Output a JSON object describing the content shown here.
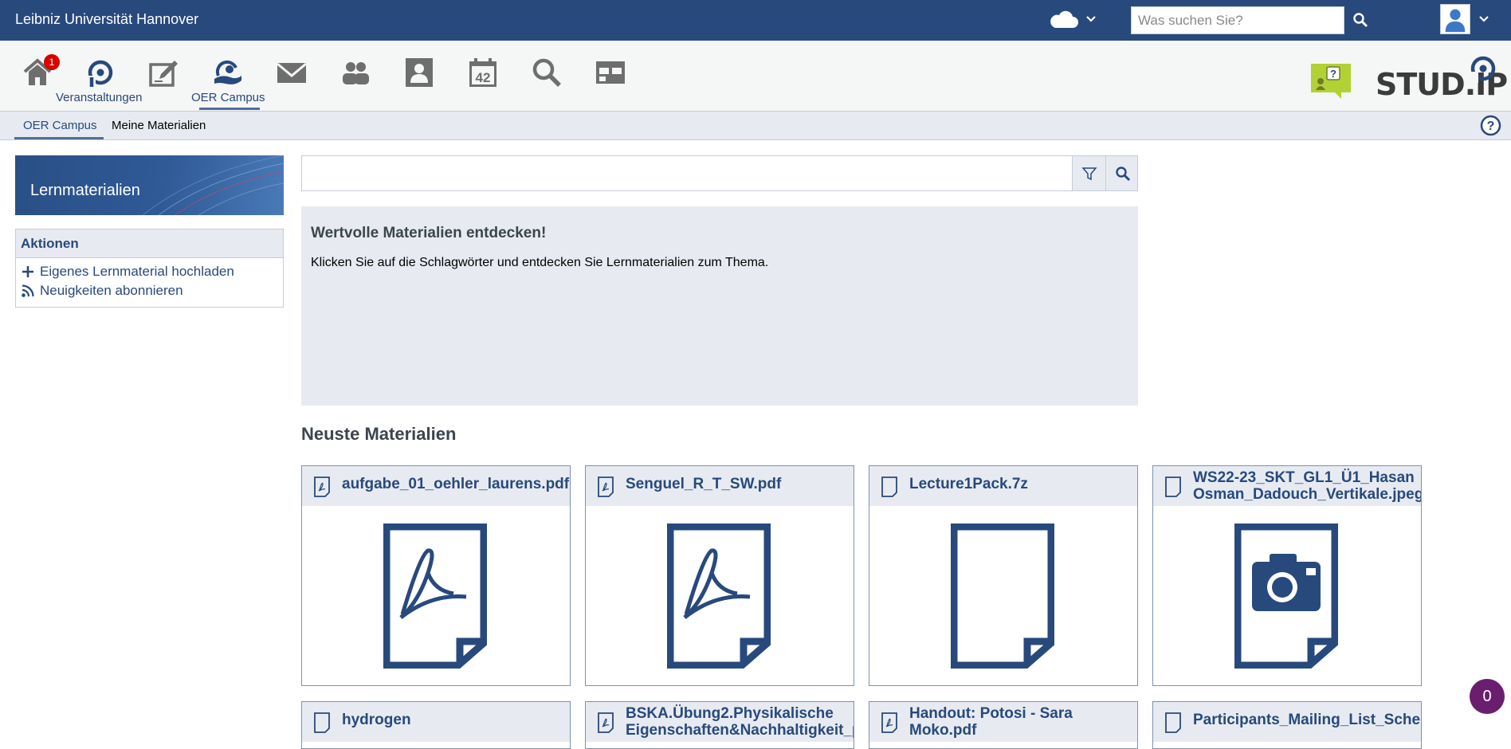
{
  "header": {
    "university": "Leibniz Universität Hannover",
    "search_placeholder": "Was suchen Sie?",
    "icons": [
      "cloud-icon",
      "chevron-down-icon",
      "search-icon",
      "avatar-icon"
    ]
  },
  "nav": {
    "home_badge": "1",
    "items": [
      {
        "icon": "home-icon",
        "label": ""
      },
      {
        "icon": "courses-icon",
        "label": "Veranstaltungen"
      },
      {
        "icon": "edit-icon",
        "label": ""
      },
      {
        "icon": "oer-campus-icon",
        "label": "OER Campus"
      },
      {
        "icon": "mail-icon",
        "label": ""
      },
      {
        "icon": "community-icon",
        "label": ""
      },
      {
        "icon": "profile-icon",
        "label": ""
      },
      {
        "icon": "calendar-icon",
        "label": ""
      },
      {
        "icon": "search-icon",
        "label": ""
      },
      {
        "icon": "tools-icon",
        "label": ""
      }
    ],
    "calendar_day": "42",
    "logo_text": "STUD.IP"
  },
  "tabs": {
    "items": [
      "OER Campus",
      "Meine Materialien"
    ],
    "active": "OER Campus"
  },
  "sidebar": {
    "banner_title": "Lernmaterialien",
    "actions_title": "Aktionen",
    "actions": [
      {
        "icon": "plus-icon",
        "label": "Eigenes Lernmaterial hochladen"
      },
      {
        "icon": "rss-icon",
        "label": "Neuigkeiten abonnieren"
      }
    ]
  },
  "main": {
    "search_value": "",
    "discover_title": "Wertvolle Materialien entdecken!",
    "discover_text": "Klicken Sie auf die Schlagwörter und entdecken Sie Lernmaterialien zum Thema.",
    "section_title": "Neuste Materialien",
    "cards": [
      {
        "title": "aufgabe_01_oehler_laurens.pdf",
        "type": "pdf"
      },
      {
        "title": "Senguel_R_T_SW.pdf",
        "type": "pdf"
      },
      {
        "title": "Lecture1Pack.7z",
        "type": "file"
      },
      {
        "title_line1": "WS22-23_SKT_GL1_Ü1_Hasan",
        "title_line2": "Osman_Dadouch_Vertikale.jpeg",
        "type": "image"
      },
      {
        "title": "hydrogen",
        "type": "file"
      },
      {
        "title_line1": "BSKA.Übung2.Physikalische",
        "title_line2": "Eigenschaften&Nachhaltigkeit_p",
        "type": "pdf"
      },
      {
        "title_line1": "Handout: Potosi - Sara",
        "title_line2": "Moko.pdf",
        "type": "pdf"
      },
      {
        "title": "Participants_Mailing_List_Sched",
        "type": "file"
      }
    ]
  },
  "chat_count": "0",
  "colors": {
    "primary": "#28497c",
    "light": "#e7ebf1",
    "badge": "#d60000",
    "chat": "#6a1e6e"
  }
}
